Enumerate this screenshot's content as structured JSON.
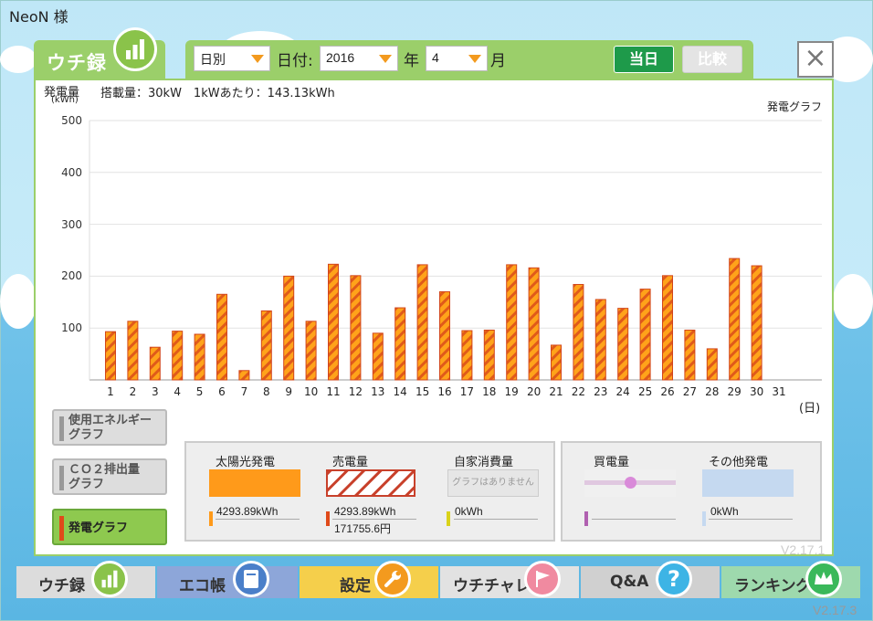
{
  "app": {
    "user_name": "NeoN 様",
    "version": "V2.17.3",
    "version_ghost": "V2.17.1"
  },
  "header": {
    "tab_label": "ウチ録",
    "mode_select": "日別",
    "date_label": "日付:",
    "year_value": "2016",
    "year_suffix": "年",
    "month_value": "4",
    "month_suffix": "月",
    "today_button": "当日",
    "compare_button": "比較",
    "close_label": "×"
  },
  "chart_info": {
    "title_left": "発電量",
    "title_unit": "(kWh)",
    "capacity_text": "搭載量：30kW　1kWあたり：143.13kWh",
    "graph_name": "発電グラフ",
    "x_unit": "(日)"
  },
  "chart_data": {
    "type": "bar",
    "categories": [
      "1",
      "2",
      "3",
      "4",
      "5",
      "6",
      "7",
      "8",
      "9",
      "10",
      "11",
      "12",
      "13",
      "14",
      "15",
      "16",
      "17",
      "18",
      "19",
      "20",
      "21",
      "22",
      "23",
      "24",
      "25",
      "26",
      "27",
      "28",
      "29",
      "30",
      "31"
    ],
    "series": [
      {
        "name": "発電量",
        "values": [
          93,
          113,
          63,
          94,
          88,
          165,
          18,
          133,
          200,
          113,
          223,
          201,
          90,
          139,
          222,
          170,
          95,
          96,
          222,
          216,
          67,
          184,
          155,
          138,
          175,
          201,
          96,
          60,
          234,
          220,
          null
        ]
      }
    ],
    "ylabel": "発電量",
    "ylim": [
      0,
      500
    ],
    "yticks": [
      "500",
      "400",
      "300",
      "200",
      "100"
    ],
    "xlabel": "(日)",
    "grid": true,
    "colors": {
      "fill": "#ffa31a",
      "stripe": "#e05a1a"
    }
  },
  "side_buttons": [
    {
      "label": "使用エネルギーグラフ",
      "line1": "使用エネルギー",
      "line2": "グラフ"
    },
    {
      "label": "CO2排出量グラフ",
      "line1": "ＣＯ２排出量",
      "line2": "グラフ"
    },
    {
      "label": "発電グラフ",
      "line1": "発電グラフ",
      "line2": ""
    }
  ],
  "legend": {
    "solar": {
      "title": "太陽光発電",
      "value": "4293.89kWh",
      "color": "#ff9a1a"
    },
    "sell": {
      "title": "売電量",
      "value1": "4293.89kWh",
      "value2": "171755.6円",
      "color": "#e04a1a"
    },
    "self": {
      "title": "自家消費量",
      "empty_text": "グラフはありません",
      "value": "0kWh",
      "color": "#d9d21a"
    },
    "buy": {
      "title": "買電量",
      "color": "#b060b0"
    },
    "other": {
      "title": "その他発電",
      "value": "0kWh",
      "color": "#c5d9f0"
    }
  },
  "nav": [
    {
      "label": "ウチ録",
      "color": "#dddddd",
      "icon": "bar-chart-icon"
    },
    {
      "label": "エコ帳",
      "color": "#8da6d9",
      "icon": "notebook-icon"
    },
    {
      "label": "設定",
      "color": "#f5cf4b",
      "icon": "wrench-icon"
    },
    {
      "label": "ウチチャレ",
      "color": "#e0e0e0",
      "icon": "flag-icon"
    },
    {
      "label": "Q&A",
      "color": "#cfcfcf",
      "icon": "question-icon"
    },
    {
      "label": "ランキング",
      "color": "#9ed9ad",
      "icon": "crown-icon"
    }
  ]
}
